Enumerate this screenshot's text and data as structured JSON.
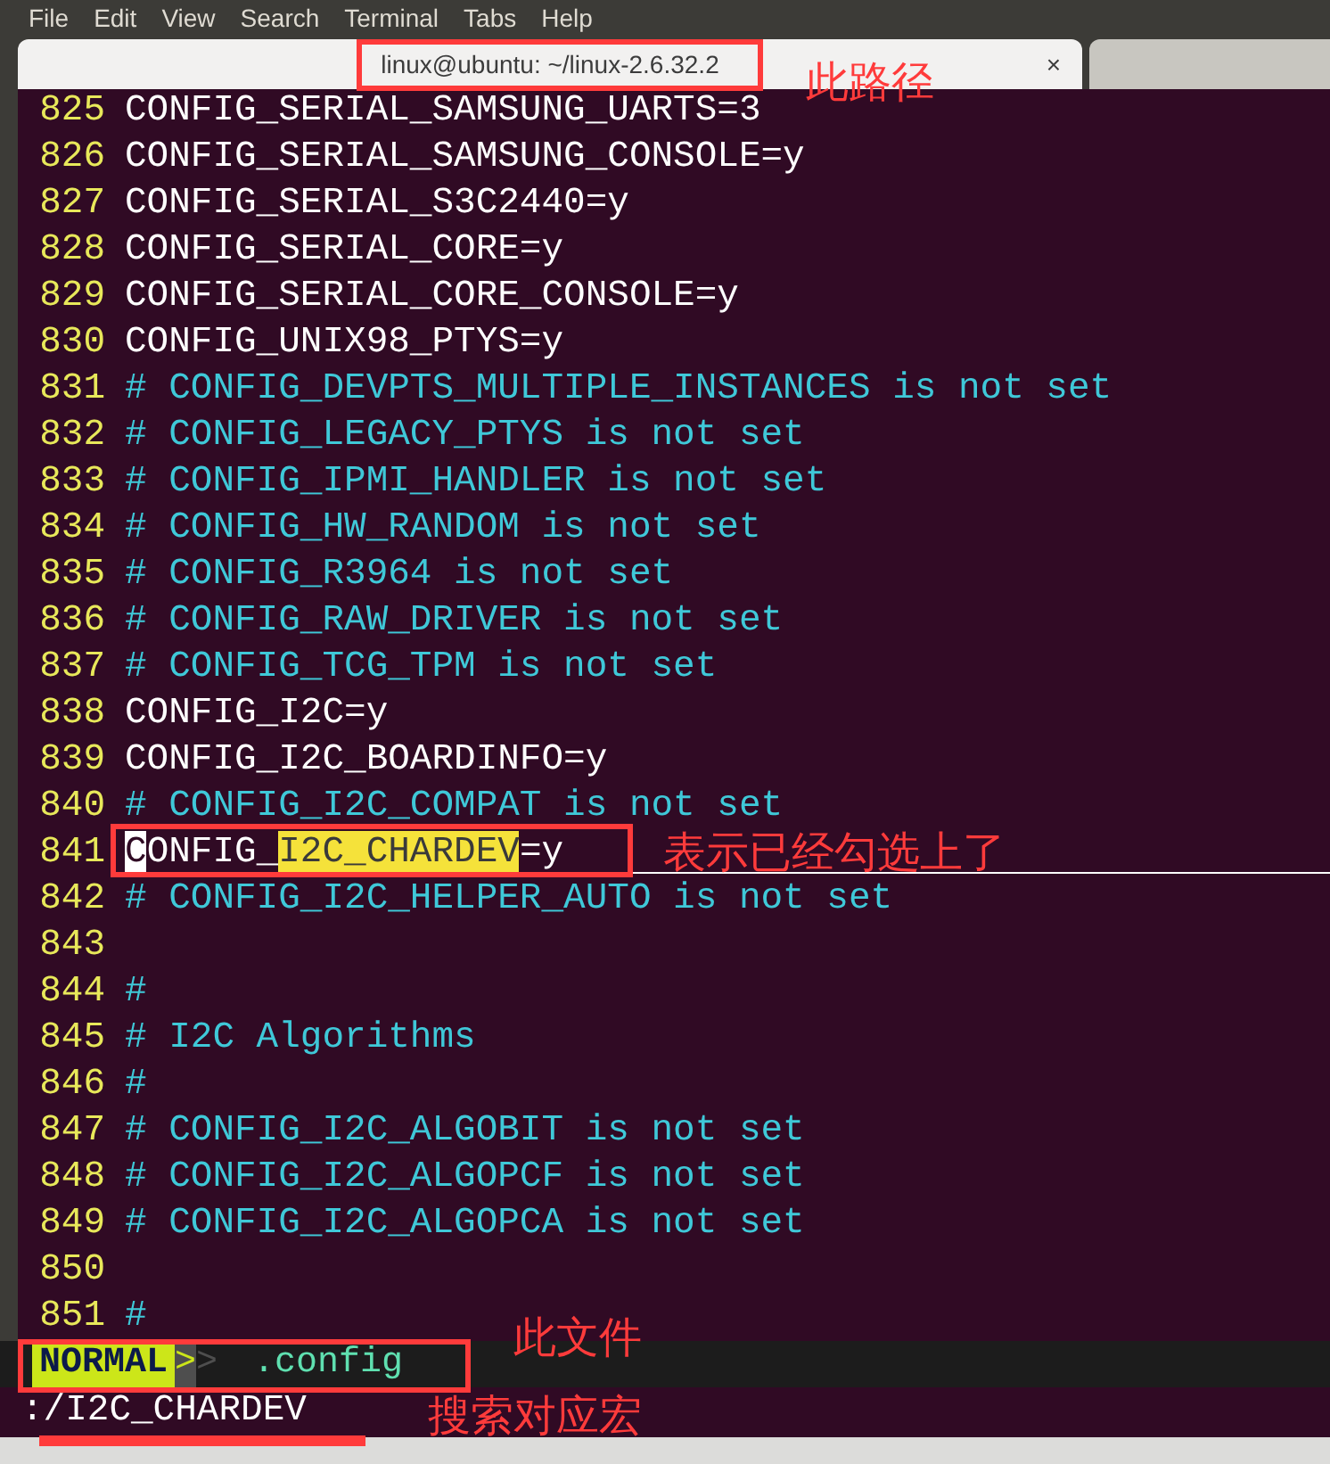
{
  "menu": [
    "File",
    "Edit",
    "View",
    "Search",
    "Terminal",
    "Tabs",
    "Help"
  ],
  "tabs": [
    {
      "title": "linux@ubuntu: ~/linux-2.6.32.2",
      "close": "×",
      "selected": true
    },
    {
      "selected": false
    }
  ],
  "lines": [
    {
      "number": "825",
      "kind": "setting",
      "text": "CONFIG_SERIAL_SAMSUNG_UARTS=3"
    },
    {
      "number": "826",
      "kind": "setting",
      "text": "CONFIG_SERIAL_SAMSUNG_CONSOLE=y"
    },
    {
      "number": "827",
      "kind": "setting",
      "text": "CONFIG_SERIAL_S3C2440=y"
    },
    {
      "number": "828",
      "kind": "setting",
      "text": "CONFIG_SERIAL_CORE=y"
    },
    {
      "number": "829",
      "kind": "setting",
      "text": "CONFIG_SERIAL_CORE_CONSOLE=y"
    },
    {
      "number": "830",
      "kind": "setting",
      "text": "CONFIG_UNIX98_PTYS=y"
    },
    {
      "number": "831",
      "kind": "comment",
      "text": "# CONFIG_DEVPTS_MULTIPLE_INSTANCES is not set"
    },
    {
      "number": "832",
      "kind": "comment",
      "text": "# CONFIG_LEGACY_PTYS is not set"
    },
    {
      "number": "833",
      "kind": "comment",
      "text": "# CONFIG_IPMI_HANDLER is not set"
    },
    {
      "number": "834",
      "kind": "comment",
      "text": "# CONFIG_HW_RANDOM is not set"
    },
    {
      "number": "835",
      "kind": "comment",
      "text": "# CONFIG_R3964 is not set"
    },
    {
      "number": "836",
      "kind": "comment",
      "text": "# CONFIG_RAW_DRIVER is not set"
    },
    {
      "number": "837",
      "kind": "comment",
      "text": "# CONFIG_TCG_TPM is not set"
    },
    {
      "number": "838",
      "kind": "setting",
      "text": "CONFIG_I2C=y"
    },
    {
      "number": "839",
      "kind": "setting",
      "text": "CONFIG_I2C_BOARDINFO=y"
    },
    {
      "number": "840",
      "kind": "comment",
      "text": "# CONFIG_I2C_COMPAT is not set"
    },
    {
      "number": "841",
      "kind": "setting",
      "cursorline": true,
      "segments": [
        {
          "kind": "cursor",
          "text": "C"
        },
        {
          "kind": "plain",
          "text": "ONFIG_"
        },
        {
          "kind": "match",
          "text": "I2C_CHARDEV"
        },
        {
          "kind": "plain",
          "text": "=y"
        }
      ]
    },
    {
      "number": "842",
      "kind": "comment",
      "text": "# CONFIG_I2C_HELPER_AUTO is not set"
    },
    {
      "number": "843",
      "kind": "blank"
    },
    {
      "number": "844",
      "kind": "comment",
      "text": "#"
    },
    {
      "number": "845",
      "kind": "comment",
      "text": "# I2C Algorithms"
    },
    {
      "number": "846",
      "kind": "comment",
      "text": "#"
    },
    {
      "number": "847",
      "kind": "comment",
      "text": "# CONFIG_I2C_ALGOBIT is not set"
    },
    {
      "number": "848",
      "kind": "comment",
      "text": "# CONFIG_I2C_ALGOPCF is not set"
    },
    {
      "number": "849",
      "kind": "comment",
      "text": "# CONFIG_I2C_ALGOPCA is not set"
    },
    {
      "number": "850",
      "kind": "blank"
    },
    {
      "number": "851",
      "kind": "comment",
      "text": "#"
    }
  ],
  "status_line": {
    "mode": "NORMAL",
    "separator": ">",
    "arrow": ">",
    "file": ".config"
  },
  "command_line": ":/I2C_CHARDEV",
  "annotations": [
    {
      "text": "此路径"
    },
    {
      "text": "表示已经勾选上了"
    },
    {
      "text": "此文件"
    },
    {
      "text": "搜索对应宏"
    }
  ]
}
